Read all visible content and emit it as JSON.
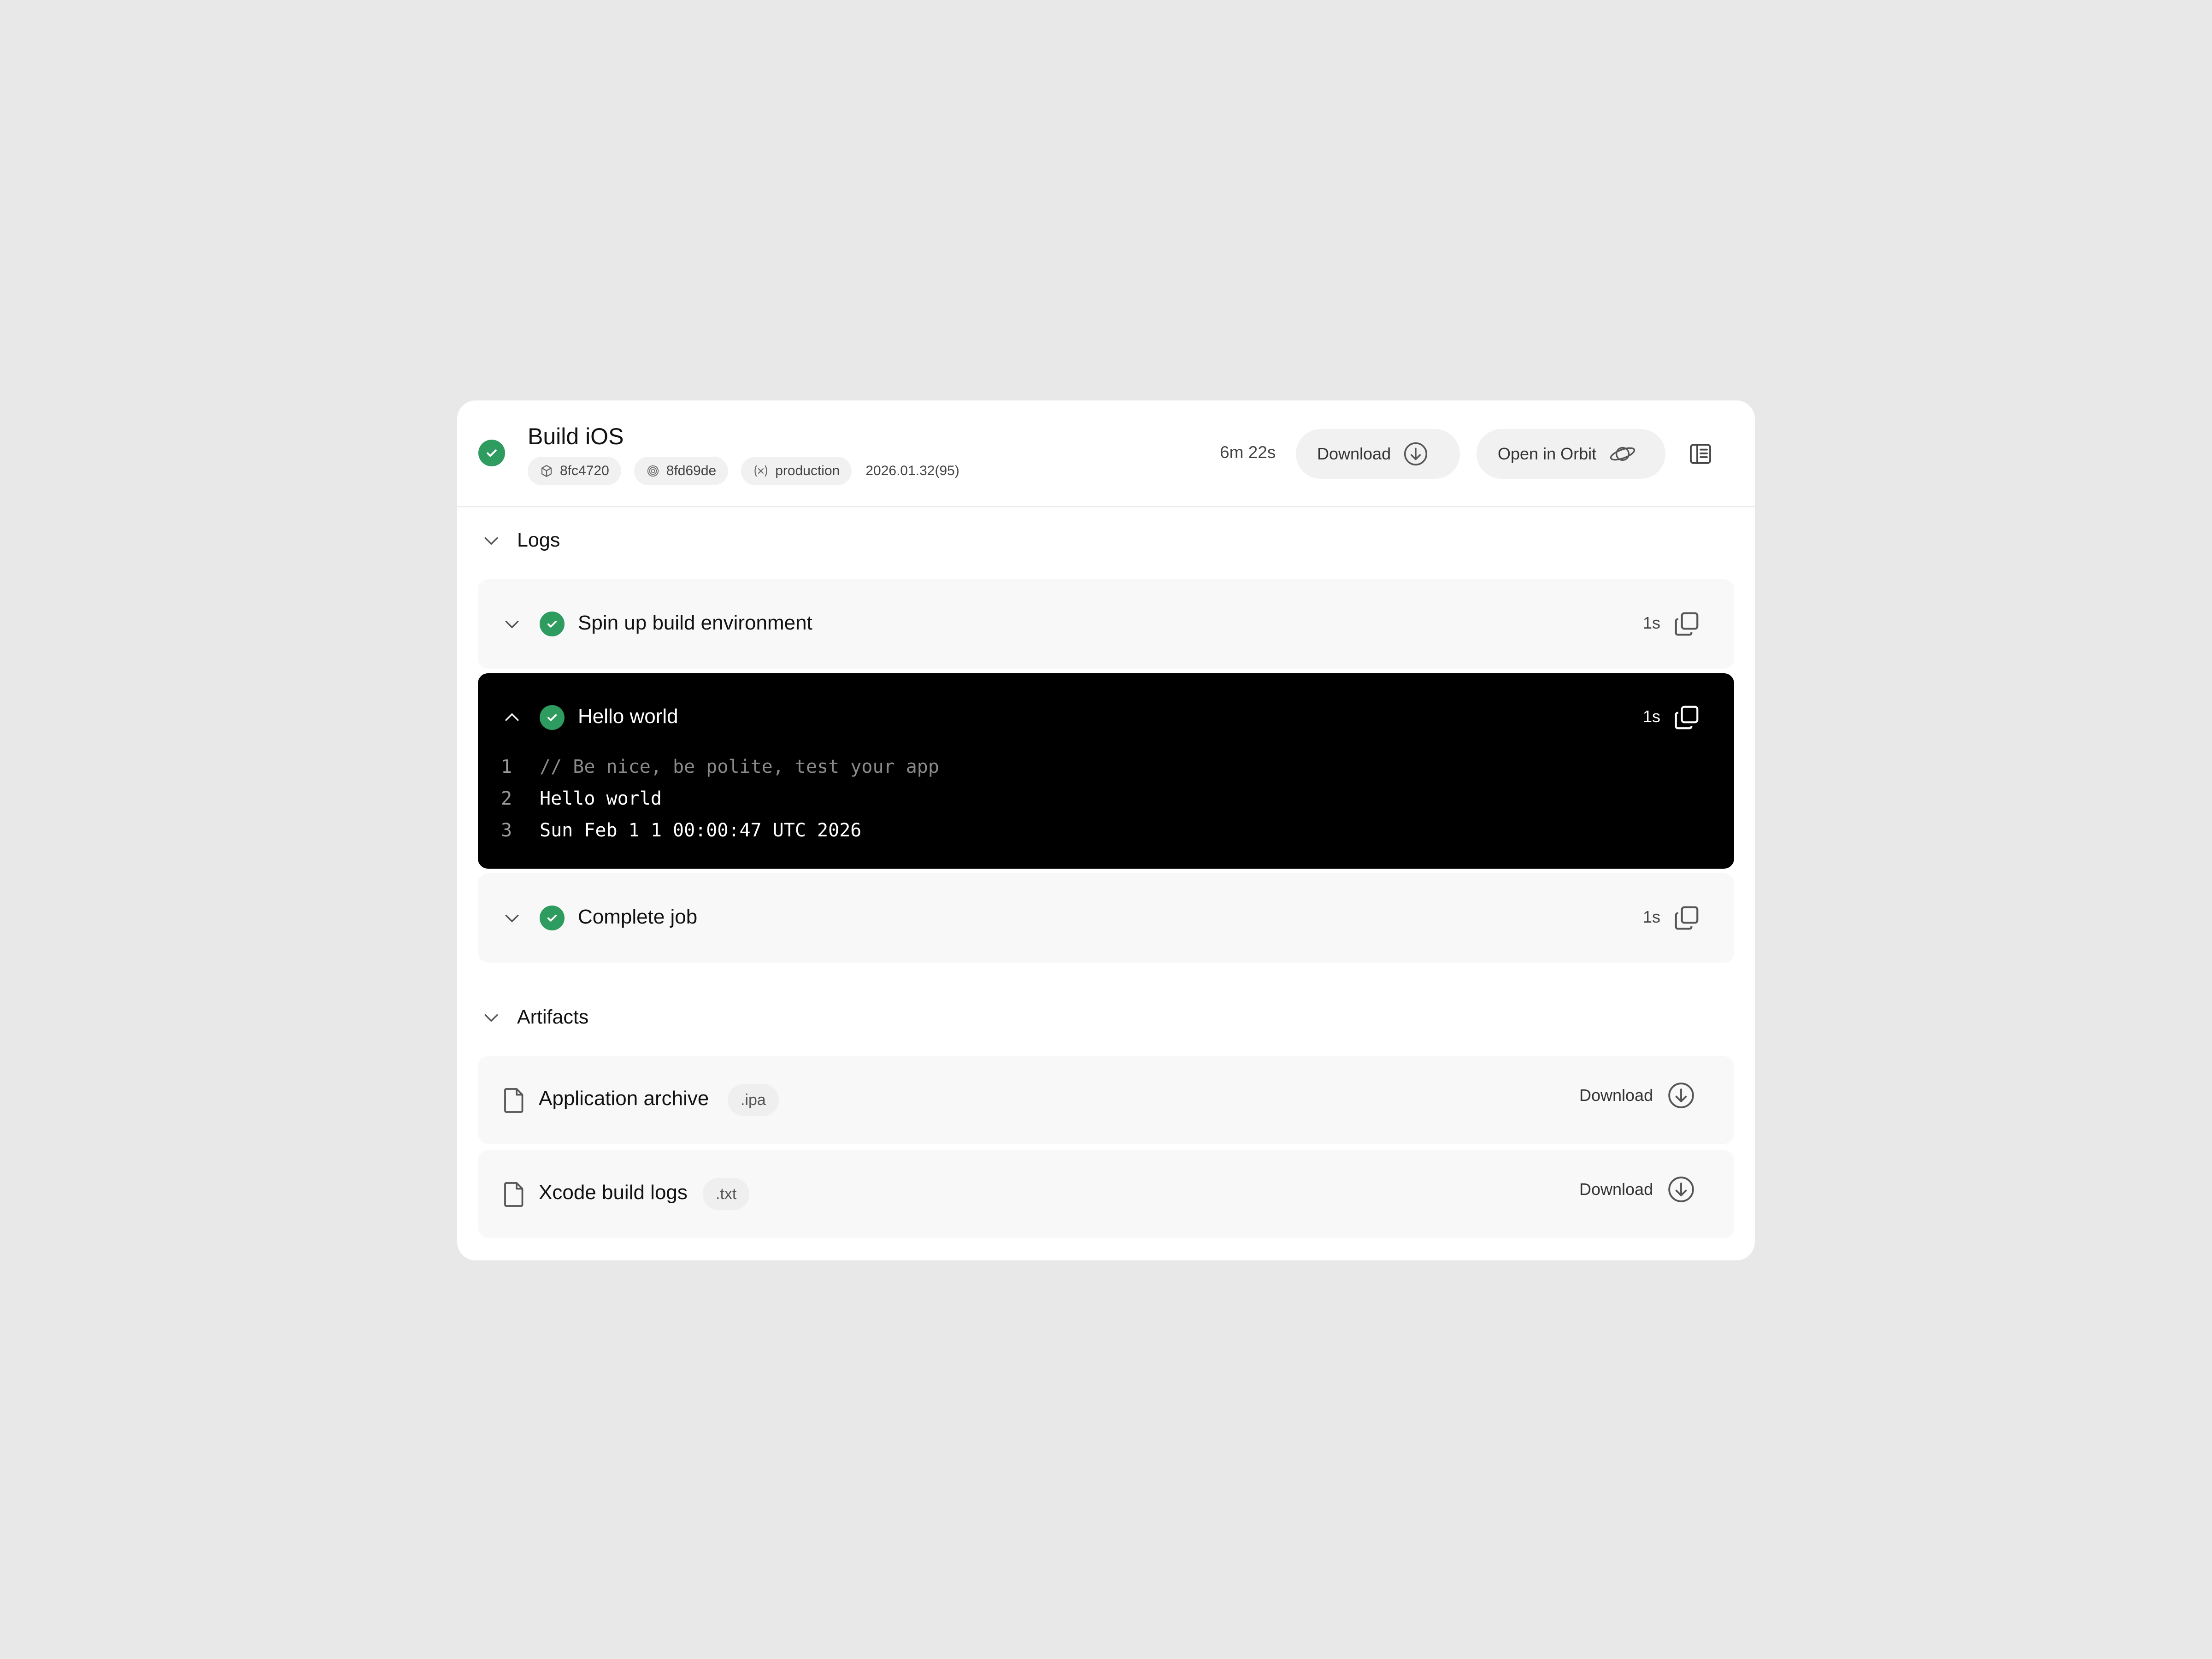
{
  "build": {
    "title": "Build iOS",
    "status": "success",
    "commit": "8fc4720",
    "fingerprint": "8fd69de",
    "environment": "production",
    "version": "2026.01.32(95)",
    "duration": "6m 22s"
  },
  "header": {
    "download_label": "Download",
    "orbit_label": "Open in Orbit"
  },
  "logs": {
    "label": "Logs",
    "steps": [
      {
        "label": "Spin up build environment",
        "time": "1s",
        "expanded": false
      },
      {
        "label": "Hello world",
        "time": "1s",
        "expanded": true,
        "lines": [
          {
            "n": "1",
            "text": "// Be nice, be polite, test your app"
          },
          {
            "n": "2",
            "text": "Hello world"
          },
          {
            "n": "3",
            "text": "Sun Feb 1 1 00:00:47 UTC 2026"
          }
        ]
      },
      {
        "label": "Complete job",
        "time": "1s",
        "expanded": false
      }
    ]
  },
  "artifacts": {
    "label": "Artifacts",
    "items": [
      {
        "name": "Application archive",
        "ext": ".ipa",
        "download_label": "Download"
      },
      {
        "name": "Xcode build logs",
        "ext": ".txt",
        "download_label": "Download"
      }
    ]
  },
  "colors": {
    "success": "#2e9b5f",
    "terminal_bg": "#000000",
    "page_bg": "#e8e8e8"
  },
  "icons": [
    "check-circle-icon",
    "cube-icon",
    "fingerprint-icon",
    "variable-icon",
    "download-circle-icon",
    "planet-icon",
    "side-panel-icon",
    "chevron-down-icon",
    "chevron-up-icon",
    "copy-icon",
    "file-icon"
  ]
}
